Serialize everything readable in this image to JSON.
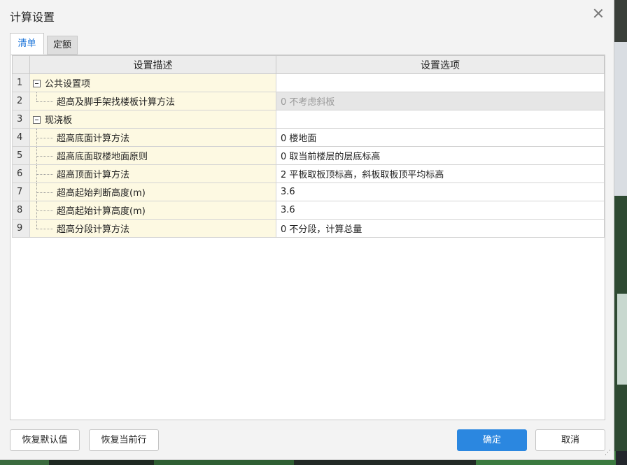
{
  "dialog": {
    "title": "计算设置"
  },
  "tabs": [
    {
      "label": "清单",
      "active": true
    },
    {
      "label": "定额",
      "active": false
    }
  ],
  "table": {
    "headers": [
      "设置描述",
      "设置选项"
    ],
    "rows": [
      {
        "num": "1",
        "desc": "公共设置项",
        "option": "",
        "type": "group"
      },
      {
        "num": "2",
        "desc": "超高及脚手架找楼板计算方法",
        "option": "0 不考虑斜板",
        "type": "child",
        "disabled": true
      },
      {
        "num": "3",
        "desc": "现浇板",
        "option": "",
        "type": "group"
      },
      {
        "num": "4",
        "desc": "超高底面计算方法",
        "option": "0 楼地面",
        "type": "child"
      },
      {
        "num": "5",
        "desc": "超高底面取楼地面原则",
        "option": "0 取当前楼层的层底标高",
        "type": "child"
      },
      {
        "num": "6",
        "desc": "超高顶面计算方法",
        "option": "2 平板取板顶标高，斜板取板顶平均标高",
        "type": "child"
      },
      {
        "num": "7",
        "desc": "超高起始判断高度(m)",
        "option": "3.6",
        "type": "child"
      },
      {
        "num": "8",
        "desc": "超高起始计算高度(m)",
        "option": "3.6",
        "type": "child"
      },
      {
        "num": "9",
        "desc": "超高分段计算方法",
        "option": "0 不分段，计算总量",
        "type": "child"
      }
    ]
  },
  "buttons": {
    "restore_default": "恢复默认值",
    "restore_row": "恢复当前行",
    "ok": "确定",
    "cancel": "取消"
  },
  "colors": {
    "primary": "#2b87e0",
    "tab_active_text": "#1a73d9",
    "desc_bg": "#fdf9e2"
  }
}
